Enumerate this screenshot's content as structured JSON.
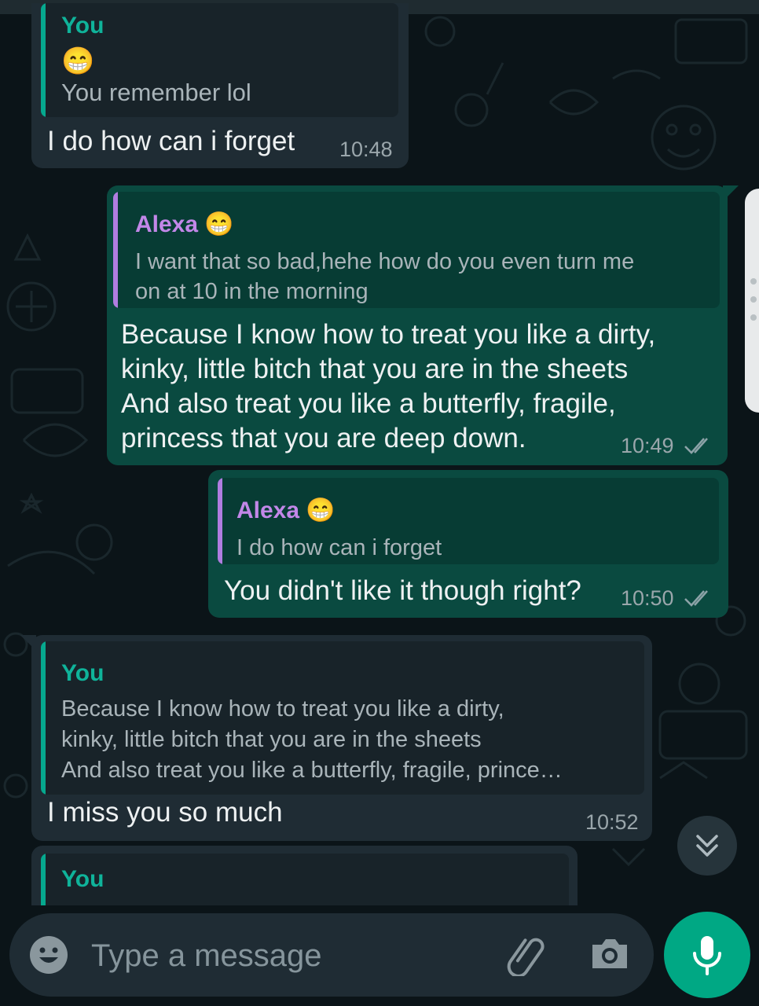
{
  "messages": [
    {
      "direction": "incoming",
      "quote": {
        "author": "You",
        "emoji": "😁",
        "text": "You remember lol"
      },
      "text": "I do how can i forget",
      "time": "10:48"
    },
    {
      "direction": "outgoing",
      "quote": {
        "author": "Alexa",
        "emoji": "😁",
        "line1": "I want that so bad,hehe how do you even turn me",
        "line2": "on at 10 in the morning"
      },
      "lines": [
        "Because I know how to treat you like a dirty,",
        "kinky, little bitch that you are in the sheets",
        "And also treat you like a butterfly, fragile,",
        "princess that you are deep down."
      ],
      "time": "10:49",
      "status": "read"
    },
    {
      "direction": "outgoing",
      "quote": {
        "author": "Alexa",
        "emoji": "😁",
        "text": "I do how can i forget"
      },
      "text": "You didn't like it though right?",
      "time": "10:50",
      "status": "read"
    },
    {
      "direction": "incoming",
      "quote": {
        "author": "You",
        "line1": "Because I know how to treat you like a dirty,",
        "line2": "kinky, little bitch that you are in the sheets",
        "line3": "And also treat you like a butterfly, fragile, prince…"
      },
      "text": "I miss you so much",
      "time": "10:52"
    },
    {
      "direction": "incoming",
      "quote": {
        "author": "You"
      }
    }
  ],
  "composer": {
    "placeholder": "Type a message",
    "icons": [
      "emoji-icon",
      "attach-icon",
      "camera-icon",
      "mic-icon"
    ]
  },
  "scroll_down_icon": "double-chevron-down-icon",
  "colors": {
    "background": "#0b1418",
    "incoming_bubble": "#1f2c34",
    "outgoing_bubble": "#0a4a40",
    "accent": "#00a884",
    "quote_you": "#0fb39a",
    "quote_alexa": "#c287e8"
  }
}
